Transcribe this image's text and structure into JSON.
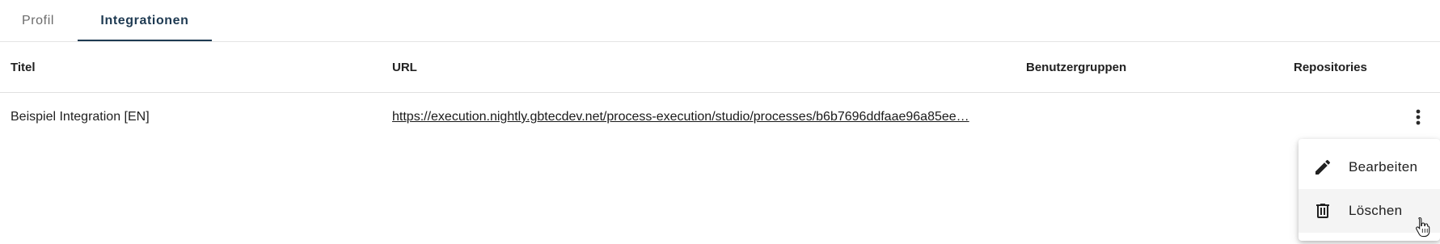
{
  "tabs": {
    "profil": "Profil",
    "integrationen": "Integrationen",
    "active": "Integrationen"
  },
  "table": {
    "headers": {
      "titel": "Titel",
      "url": "URL",
      "benutzergruppen": "Benutzergruppen",
      "repositories": "Repositories"
    },
    "rows": [
      {
        "titel": "Beispiel Integration [EN]",
        "url": "https://execution.nightly.gbtecdev.net/process-execution/studio/processes/b6b7696ddfaae96a85ee…",
        "benutzergruppen": "",
        "repositories": ""
      }
    ]
  },
  "menu": {
    "edit_label": "Bearbeiten",
    "delete_label": "Löschen"
  },
  "icons": {
    "more": "more-vert-icon",
    "edit": "pencil-icon",
    "delete": "trash-icon",
    "cursor": "hand-pointer-cursor"
  },
  "colors": {
    "accent": "#1e3a52",
    "inactive_tab": "#6b6b6b",
    "text": "#212121"
  }
}
